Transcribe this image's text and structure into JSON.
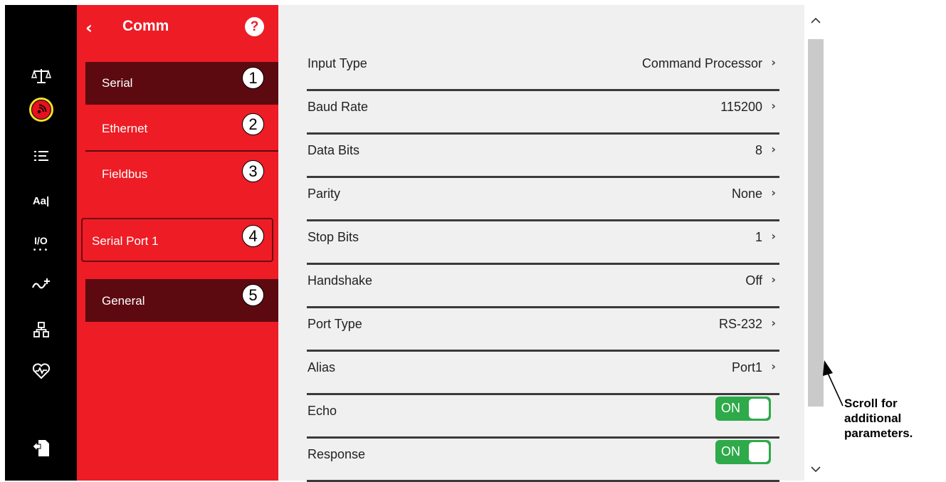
{
  "panel": {
    "title": "Comm",
    "help": "?",
    "nav": [
      {
        "label": "Serial",
        "num": "1"
      },
      {
        "label": "Ethernet",
        "num": "2"
      },
      {
        "label": "Fieldbus",
        "num": "3"
      },
      {
        "label": "Serial Port 1",
        "num": "4"
      },
      {
        "label": "General",
        "num": "5"
      }
    ]
  },
  "rail": {
    "icons": [
      "scale-icon",
      "comm-icon",
      "list-icon",
      "text-icon",
      "io-icon",
      "flow-icon",
      "hierarchy-icon",
      "health-icon",
      "export-icon"
    ],
    "text_icon_label": "Aa|",
    "io_icon_label": "I/O"
  },
  "settings": [
    {
      "label": "Input Type",
      "value": "Command Processor"
    },
    {
      "label": "Baud Rate",
      "value": "115200"
    },
    {
      "label": "Data Bits",
      "value": "8"
    },
    {
      "label": "Parity",
      "value": "None"
    },
    {
      "label": "Stop Bits",
      "value": "1"
    },
    {
      "label": "Handshake",
      "value": "Off"
    },
    {
      "label": "Port Type",
      "value": "RS-232"
    },
    {
      "label": "Alias",
      "value": "Port1"
    },
    {
      "label": "Echo",
      "toggle": "ON"
    },
    {
      "label": "Response",
      "toggle": "ON"
    }
  ],
  "callout": {
    "line1": "Scroll for",
    "line2": "additional",
    "line3": "parameters."
  },
  "colors": {
    "panel_red": "#ee1c25",
    "selected_dark": "#5c0a10",
    "toggle_green": "#2eaa4a",
    "highlight_ring": "#f2e02a"
  }
}
